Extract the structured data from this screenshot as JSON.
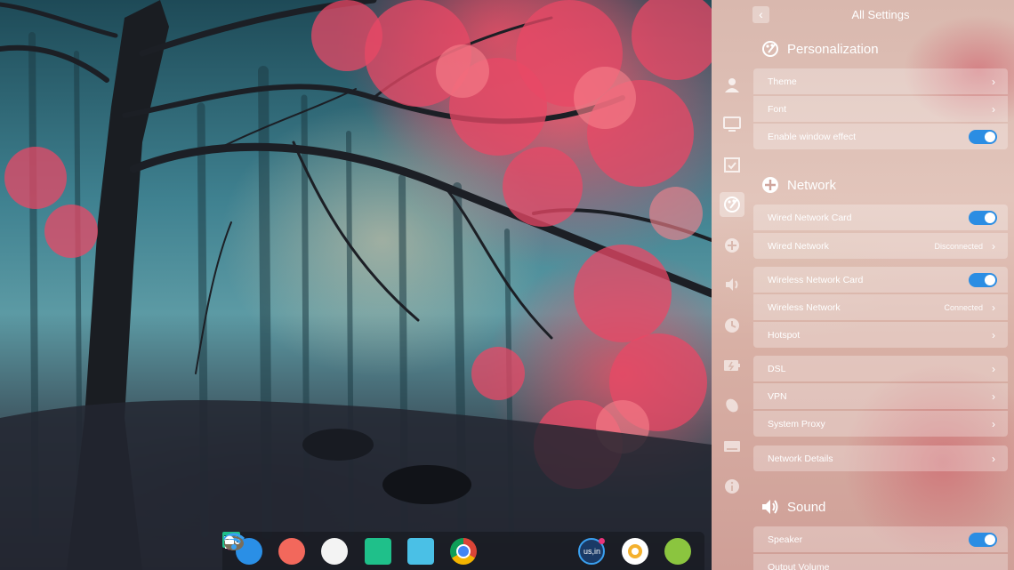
{
  "settings": {
    "back_label": "‹",
    "title": "All Settings",
    "sections": {
      "personalization": {
        "title": "Personalization",
        "theme": "Theme",
        "font": "Font",
        "window_effect": "Enable window effect",
        "window_effect_on": true
      },
      "network": {
        "title": "Network",
        "wired_card": "Wired Network Card",
        "wired_card_on": true,
        "wired_network": "Wired Network",
        "wired_status": "Disconnected",
        "wireless_card": "Wireless Network Card",
        "wireless_card_on": true,
        "wireless_network": "Wireless Network",
        "wireless_status": "Connected",
        "hotspot": "Hotspot",
        "dsl": "DSL",
        "vpn": "VPN",
        "proxy": "System Proxy",
        "details": "Network Details"
      },
      "sound": {
        "title": "Sound",
        "speaker": "Speaker",
        "speaker_on": true,
        "output_volume": "Output Volume"
      }
    },
    "nav_icons": [
      "user-icon",
      "display-icon",
      "calendar-icon",
      "personalization-icon",
      "network-icon",
      "sound-icon",
      "clock-icon",
      "power-icon",
      "mouse-icon",
      "keyboard-icon",
      "info-icon"
    ],
    "active_nav": "personalization-icon"
  },
  "dock": {
    "apps": [
      "launcher-icon",
      "multitask-icon",
      "settings-icon",
      "terminal-icon",
      "app-store-icon",
      "chrome-icon",
      "gimp-icon",
      "wifi-icon",
      "keyboard-layout-icon",
      "recorder-icon",
      "android-icon"
    ],
    "keyboard_layout": "us,in"
  },
  "colors": {
    "accent": "#2b8de3",
    "row_bg": "rgba(255,255,255,0.28)"
  }
}
